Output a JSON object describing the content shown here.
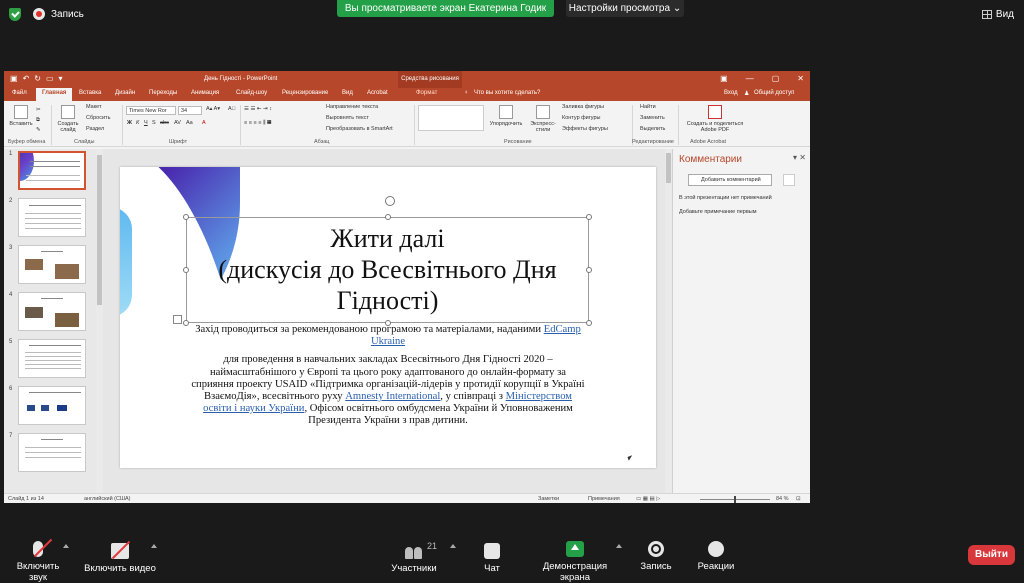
{
  "zoom": {
    "recording_label": "Запись",
    "share_banner": "Вы просматриваете экран Екатерина Годик",
    "view_options": "Настройки просмотра ⌄",
    "view_label": "Вид",
    "controls": {
      "mute": "Включить звук",
      "video": "Включить видео",
      "participants": "Участники",
      "participants_count": "21",
      "chat": "Чат",
      "share": "Демонстрация экрана",
      "record": "Запись",
      "reactions": "Реакции",
      "leave": "Выйти"
    }
  },
  "ppt": {
    "window_title": "День Гідності - PowerPoint",
    "drawing_tools": "Средства рисования",
    "tabs": [
      "Файл",
      "Главная",
      "Вставка",
      "Дизайн",
      "Переходы",
      "Анимация",
      "Слайд-шоу",
      "Рецензирование",
      "Вид",
      "Acrobat",
      "Формат"
    ],
    "tell_me": "Что вы хотите сделать?",
    "signin": "Вход",
    "share": "Общий доступ",
    "ribbon": {
      "paste": "Вставить",
      "clipboard": "Буфер обмена",
      "new_slide": "Создать слайд",
      "layout": "Макет",
      "reset": "Сбросить",
      "section": "Раздел",
      "slides": "Слайды",
      "font_name": "Times New Ror",
      "font_size": "34",
      "font": "Шрифт",
      "text_direction": "Направление текста",
      "align_text": "Выровнять текст",
      "smartart": "Преобразовать в SmartArt",
      "paragraph": "Абзац",
      "arrange": "Упорядочить",
      "quick_styles": "Экспресс-стили",
      "shape_fill": "Заливка фигуры",
      "shape_outline": "Контур фигуры",
      "shape_effects": "Эффекты фигуры",
      "drawing": "Рисование",
      "find": "Найти",
      "replace": "Заменить",
      "select": "Выделить",
      "editing": "Редактирование",
      "adobe_create": "Создать и поделиться Adobe PDF",
      "adobe_acrobat": "Adobe Acrobat"
    },
    "slide": {
      "title": "Жити далі\n(дискусія до Всесвітнього Дня Гідності)",
      "para1_a": "Захід проводиться за рекомендованою програмою та матеріалами, наданими",
      "para1_link": "EdCamp Ukraine",
      "para2_a": "для проведення в навчальних закладах Всесвітнього Дня Гідності 2020 – наймасштабнішого у Європі та цього року адаптованого до онлайн-формату за сприяння проекту USAID «Підтримка організацій-лідерів у протидії корупції в Україні ВзаємоДія», всесвітнього руху",
      "para2_link1": "Amnesty International",
      "para2_b": ", у співпраці з",
      "para2_link2": "Міністерством освіти і науки України",
      "para2_c": ", Офісом освітнього омбудсмена України й Уповноваженим Президента України з прав дитини."
    },
    "thumbnail_numbers": [
      "1",
      "2",
      "3",
      "4",
      "5",
      "6",
      "7"
    ],
    "comments": {
      "title": "Комментарии",
      "add": "Добавить комментарий",
      "none": "В этой презентации нет примечаний",
      "hint": "Добавьте примечание первым"
    },
    "status": {
      "slide_of": "Слайд 1 из 14",
      "language": "английский (США)",
      "notes": "Заметки",
      "comments": "Примечания",
      "zoom": "84 %"
    }
  }
}
